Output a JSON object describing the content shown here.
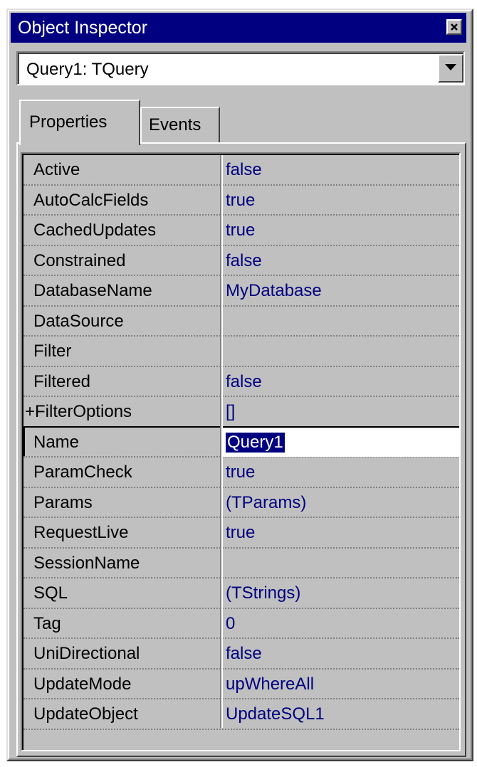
{
  "window": {
    "title": "Object Inspector"
  },
  "component_selector": {
    "value": "Query1: TQuery"
  },
  "tabs": [
    {
      "label": "Properties",
      "active": true
    },
    {
      "label": "Events",
      "active": false
    }
  ],
  "properties": [
    {
      "name": "Active",
      "value": "false"
    },
    {
      "name": "AutoCalcFields",
      "value": "true"
    },
    {
      "name": "CachedUpdates",
      "value": "true"
    },
    {
      "name": "Constrained",
      "value": "false"
    },
    {
      "name": "DatabaseName",
      "value": "MyDatabase"
    },
    {
      "name": "DataSource",
      "value": ""
    },
    {
      "name": "Filter",
      "value": ""
    },
    {
      "name": "Filtered",
      "value": "false"
    },
    {
      "name": "+FilterOptions",
      "value": "[]"
    },
    {
      "name": "Name",
      "value": "Query1"
    },
    {
      "name": "ParamCheck",
      "value": "true"
    },
    {
      "name": "Params",
      "value": "(TParams)"
    },
    {
      "name": "RequestLive",
      "value": "true"
    },
    {
      "name": "SessionName",
      "value": ""
    },
    {
      "name": "SQL",
      "value": "(TStrings)"
    },
    {
      "name": "Tag",
      "value": "0"
    },
    {
      "name": "UniDirectional",
      "value": "false"
    },
    {
      "name": "UpdateMode",
      "value": "upWhereAll"
    },
    {
      "name": "UpdateObject",
      "value": "UpdateSQL1"
    }
  ],
  "selected_property_index": 9,
  "icons": {
    "close": "close-icon",
    "dropdown": "chevron-down-icon"
  },
  "colors": {
    "title_bar": "#000080",
    "window_face": "#c0c0c0",
    "value_text": "#000080",
    "selection": "#000080"
  }
}
